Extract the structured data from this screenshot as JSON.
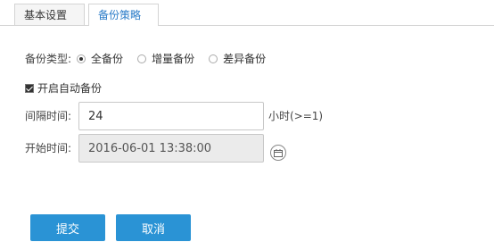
{
  "tabs": [
    {
      "label": "基本设置",
      "active": false
    },
    {
      "label": "备份策略",
      "active": true
    }
  ],
  "backup_type": {
    "label": "备份类型:",
    "options": [
      {
        "label": "全备份",
        "selected": true
      },
      {
        "label": "增量备份",
        "selected": false
      },
      {
        "label": "差异备份",
        "selected": false
      }
    ]
  },
  "auto_backup": {
    "label": "开启自动备份",
    "checked": true
  },
  "interval": {
    "label": "间隔时间:",
    "value": "24",
    "unit": "小时(>=1)"
  },
  "start_time": {
    "label": "开始时间:",
    "value": "2016-06-01 13:38:00",
    "icon": "calendar-icon"
  },
  "buttons": {
    "submit": "提交",
    "cancel": "取消"
  },
  "colors": {
    "accent": "#2a93d5",
    "tab_active_text": "#2b7cc8"
  }
}
